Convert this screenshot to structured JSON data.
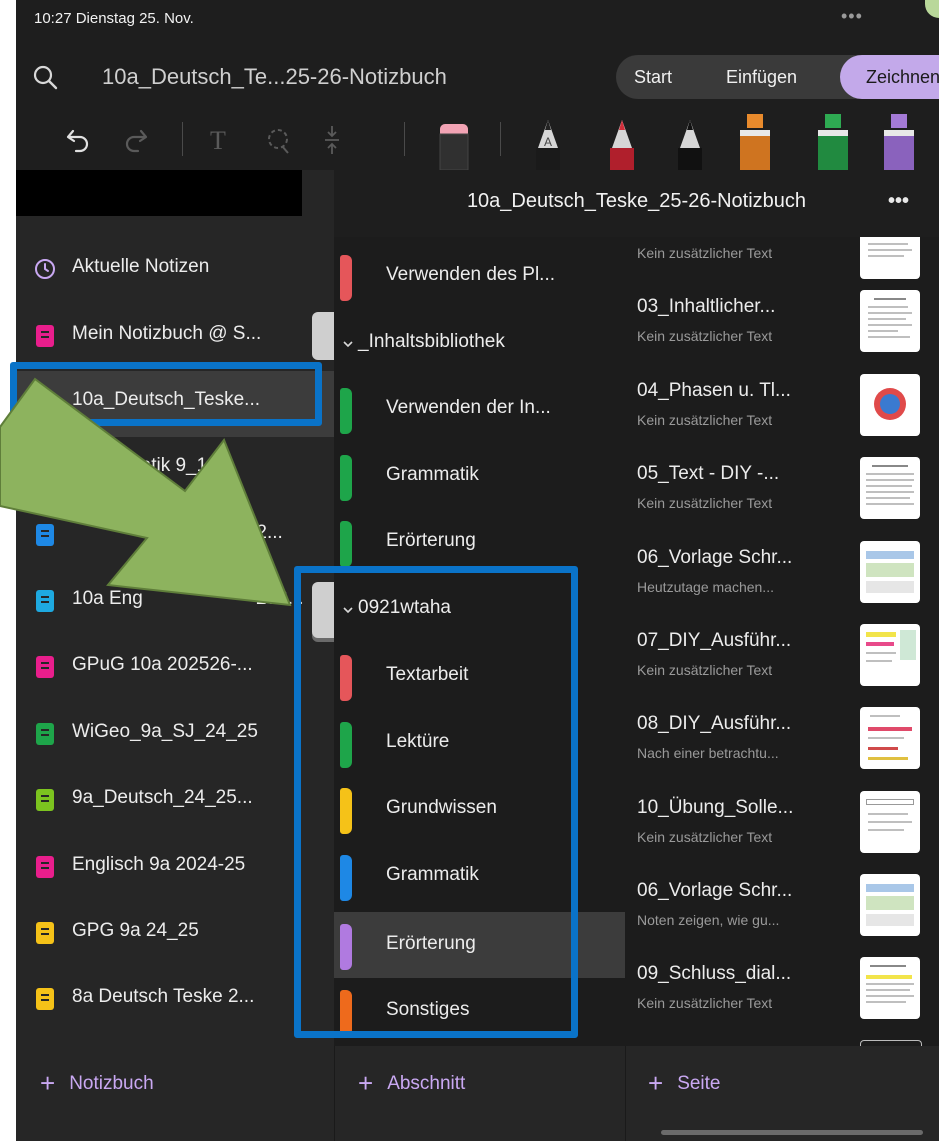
{
  "status": {
    "time_date": "10:27  Dienstag 25. Nov.",
    "more": "•••"
  },
  "titlebar": {
    "notebook_title": "10a_Deutsch_Te...25-26-Notizbuch"
  },
  "ribbon_tabs": [
    {
      "label": "Start"
    },
    {
      "label": "Einfügen"
    },
    {
      "label": "Zeichnen"
    }
  ],
  "toolbar": {
    "tools": [
      "undo-icon",
      "redo-icon",
      "text-tool-icon",
      "lasso-icon",
      "space-insert-icon",
      "eraser-icon",
      "pen-black-icon",
      "pen-red-icon",
      "pen-white-icon",
      "highlighter-orange-icon",
      "highlighter-green-icon",
      "highlighter-purple-icon"
    ]
  },
  "header": {
    "title": "10a_Deutsch_Teske_25-26-Notizbuch",
    "more": "•••"
  },
  "notebooks": [
    {
      "label": "Aktuelle Notizen",
      "color": "clock"
    },
    {
      "label": "Mein Notizbuch @ S...",
      "color": "#e91e8c"
    },
    {
      "label": "10a_Deutsch_Teske...",
      "color": "#f5c218"
    },
    {
      "label": "Mathematik 9_10a",
      "color": "#ee6a1c"
    },
    {
      "label": "nd 2...",
      "color": "#1e88e5"
    },
    {
      "label": "10a Eng",
      "label2": "252...",
      "color": "#1ea9e0"
    },
    {
      "label": "GPuG 10a 202526-...",
      "color": "#e91e8c"
    },
    {
      "label": "WiGeo_9a_SJ_24_25",
      "color": "#1ea54a"
    },
    {
      "label": "9a_Deutsch_24_25...",
      "color": "#7cc31f"
    },
    {
      "label": "Englisch 9a 2024-25",
      "color": "#e91e8c"
    },
    {
      "label": "GPG 9a 24_25",
      "color": "#f5c218"
    },
    {
      "label": "8a Deutsch Teske 2...",
      "color": "#f5c218"
    }
  ],
  "sections": [
    {
      "label": "Verwenden des Pl...",
      "color": "#e5565a"
    },
    {
      "label": "_Inhaltsbibliothek",
      "group": true
    },
    {
      "label": "Verwenden der In...",
      "color": "#1ea54a"
    },
    {
      "label": "Grammatik",
      "color": "#1ea54a"
    },
    {
      "label": "Erörterung",
      "color": "#1ea54a"
    },
    {
      "label": "0921wtaha",
      "group": true
    },
    {
      "label": "Textarbeit",
      "color": "#e5565a"
    },
    {
      "label": "Lektüre",
      "color": "#1ea54a"
    },
    {
      "label": "Grundwissen",
      "color": "#f5c218"
    },
    {
      "label": "Grammatik",
      "color": "#1e88e5"
    },
    {
      "label": "Erörterung",
      "color": "#b07ae0",
      "selected": true
    },
    {
      "label": "Sonstiges",
      "color": "#ee6a1c"
    }
  ],
  "pages": [
    {
      "title": "",
      "subtitle": "Kein zusätzlicher Text"
    },
    {
      "title": "03_Inhaltlicher...",
      "subtitle": "Kein zusätzlicher Text"
    },
    {
      "title": "04_Phasen u. Tl...",
      "subtitle": "Kein zusätzlicher Text"
    },
    {
      "title": "05_Text - DIY -...",
      "subtitle": "Kein zusätzlicher Text"
    },
    {
      "title": "06_Vorlage Schr...",
      "subtitle": "Heutzutage machen..."
    },
    {
      "title": "07_DIY_Ausführ...",
      "subtitle": "Kein zusätzlicher Text"
    },
    {
      "title": "08_DIY_Ausführ...",
      "subtitle": "Nach einer betrachtu..."
    },
    {
      "title": "10_Übung_Solle...",
      "subtitle": "Kein zusätzlicher Text"
    },
    {
      "title": "06_Vorlage Schr...",
      "subtitle": "Noten zeigen, wie gu..."
    },
    {
      "title": "09_Schluss_dial...",
      "subtitle": "Kein zusätzlicher Text"
    }
  ],
  "bottom": {
    "add_notebook": "Notizbuch",
    "add_section": "Abschnitt",
    "add_page": "Seite"
  },
  "colors": {
    "accent": "#c3a9ea",
    "highlight": "#0a73c8",
    "arrow": "#8db35e"
  }
}
